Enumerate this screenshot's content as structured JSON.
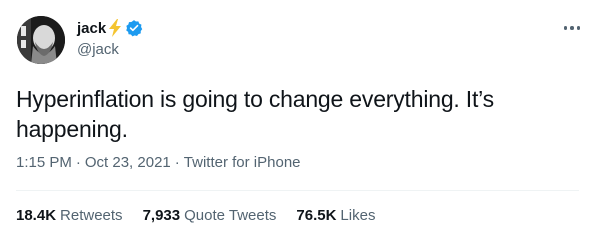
{
  "author": {
    "display_name": "jack",
    "handle": "@jack",
    "badge_icon": "lightning-bolt-icon",
    "verified_icon": "verified-badge-icon",
    "verified_color": "#1d9bf0",
    "bolt_color": "#f4c430"
  },
  "tweet": {
    "text": "Hyperinflation is going to change everything. It’s happening."
  },
  "meta": {
    "time": "1:15 PM",
    "separator": "·",
    "date": "Oct 23, 2021",
    "source": "Twitter for iPhone"
  },
  "stats": {
    "retweets_count": "18.4K",
    "retweets_label": "Retweets",
    "quotes_count": "7,933",
    "quotes_label": "Quote Tweets",
    "likes_count": "76.5K",
    "likes_label": "Likes"
  },
  "colors": {
    "text": "#0f1419",
    "secondary": "#536471",
    "divider": "#eff3f4"
  }
}
